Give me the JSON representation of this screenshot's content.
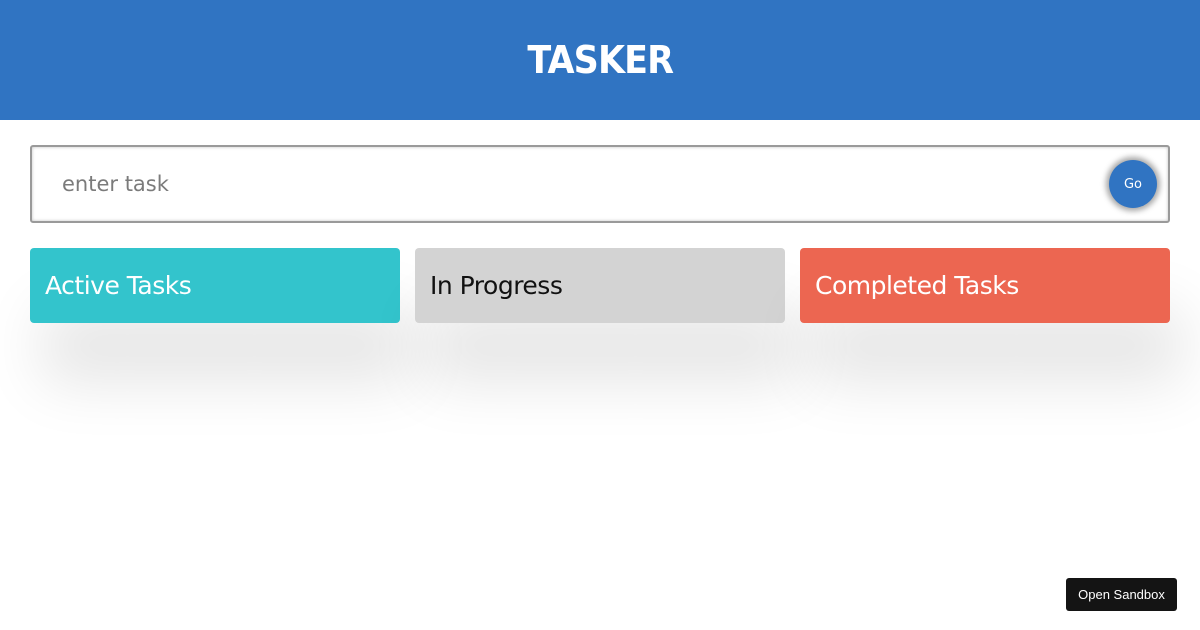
{
  "header": {
    "title": "TASKER",
    "background": "#3074c2"
  },
  "task_form": {
    "placeholder": "enter task",
    "value": "",
    "submit_label": "Go"
  },
  "columns": [
    {
      "title": "Active Tasks",
      "color": "#33c4cc"
    },
    {
      "title": "In Progress",
      "color": "#d3d3d3"
    },
    {
      "title": "Completed Tasks",
      "color": "#ec6651"
    }
  ],
  "footer": {
    "sandbox_label": "Open Sandbox"
  }
}
